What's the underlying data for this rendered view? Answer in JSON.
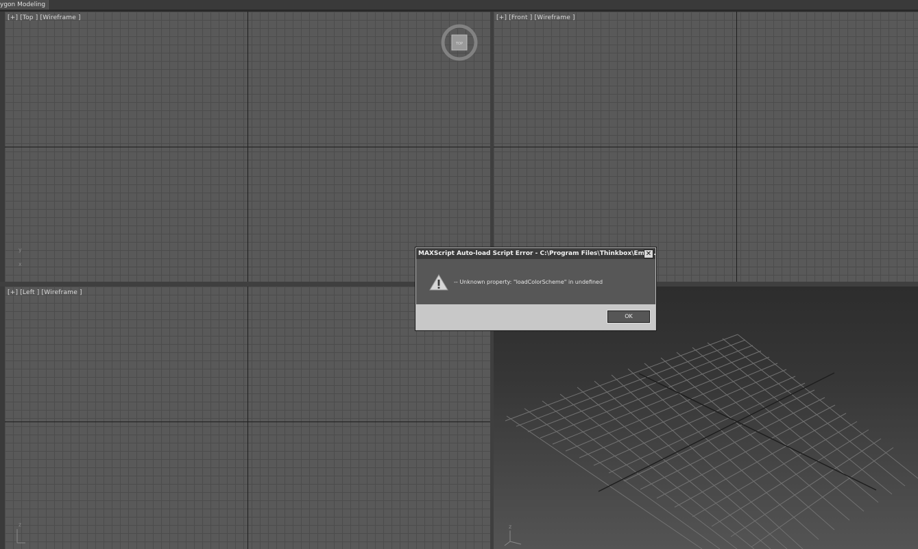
{
  "ribbon": {
    "active_tab": "ygon Modeling"
  },
  "viewports": {
    "top": {
      "label": "[+] [Top ] [Wireframe ]",
      "axis_y": "y",
      "axis_x": "x"
    },
    "front": {
      "label": "[+] [Front ] [Wireframe ]"
    },
    "left": {
      "label": "[+] [Left ] [Wireframe ]",
      "axis": "z"
    },
    "perspective": {
      "axis": "z"
    }
  },
  "viewcube": {
    "face": "TOP",
    "icon": "viewcube-icon"
  },
  "dialog": {
    "title": "MAXScript Auto-load Script Error - C:\\Program Files\\Thinkbox\\Emb...",
    "close_glyph": "✕",
    "message": "-- Unknown property: \"loadColorScheme\" in undefined",
    "ok_label": "OK",
    "icon": "warning-icon"
  },
  "colors": {
    "viewport_bg": "#595959",
    "grid_line": "#4c4c4c",
    "dialog_bg": "#575757",
    "dialog_footer": "#c8c8c8"
  }
}
